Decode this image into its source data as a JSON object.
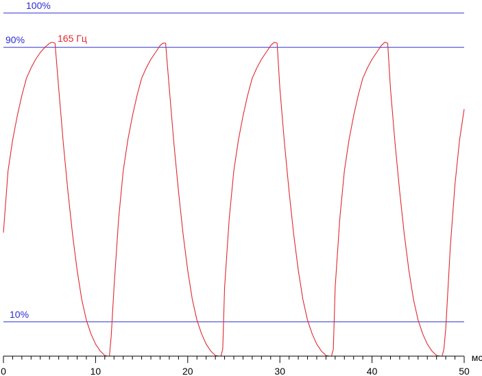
{
  "chart_data": {
    "type": "line",
    "title": "",
    "xlabel": "",
    "ylabel": "",
    "x_unit": "мс",
    "xlim": [
      0,
      50
    ],
    "ylim": [
      0,
      100
    ],
    "x_ticks": [
      0,
      10,
      20,
      30,
      40,
      50
    ],
    "x_minor_step": 1,
    "reference_lines": [
      {
        "label": "100%",
        "value": 100
      },
      {
        "label": "90%",
        "value": 90
      },
      {
        "label": "10%",
        "value": 10
      }
    ],
    "series": [
      {
        "name": "165 Гц",
        "x": [
          0,
          0.5,
          1,
          1.5,
          2,
          2.5,
          3,
          3.5,
          4,
          4.5,
          5.0,
          5.3,
          5.6,
          6,
          6.5,
          7,
          7.5,
          8,
          8.5,
          9,
          9.5,
          10,
          10.5,
          11.0,
          11.3,
          11.5,
          11.7,
          12,
          12.5,
          13,
          13.5,
          14,
          14.5,
          15,
          15.5,
          16,
          16.5,
          17.0,
          17.3,
          17.6,
          18,
          18.5,
          19,
          19.5,
          20,
          20.5,
          21,
          21.5,
          22,
          22.5,
          23.0,
          23.4,
          23.6,
          23.8,
          24,
          24.5,
          25,
          25.5,
          26,
          26.5,
          27,
          27.5,
          28,
          28.5,
          29.0,
          29.4,
          29.7,
          30,
          30.5,
          31,
          31.5,
          32,
          32.5,
          33,
          33.5,
          34,
          34.5,
          35.0,
          35.4,
          35.6,
          35.8,
          36,
          36.5,
          37,
          37.5,
          38,
          38.5,
          39,
          39.5,
          40,
          40.5,
          41.0,
          41.4,
          41.7,
          42,
          42.5,
          43,
          43.5,
          44,
          44.5,
          45,
          45.5,
          46,
          46.5,
          47.0,
          47.4,
          47.6,
          47.8,
          48,
          48.5,
          49,
          49.5,
          50.0
        ],
        "values": [
          36,
          54,
          63,
          70,
          76,
          81,
          84,
          86.5,
          88.5,
          90,
          91.2,
          91.5,
          91.2,
          78,
          62,
          48,
          35.5,
          25,
          16.5,
          10.5,
          6.5,
          3.5,
          1.5,
          0.2,
          0,
          0,
          6,
          20,
          40,
          54,
          63,
          70,
          76,
          81,
          84,
          86.5,
          88.5,
          90.5,
          91.2,
          91.2,
          78,
          62,
          48,
          35.5,
          25,
          16.5,
          10.5,
          6.5,
          3.5,
          1.5,
          0.2,
          0,
          0,
          2,
          20,
          40,
          54,
          63,
          70,
          76,
          81,
          84,
          86.5,
          88.5,
          90.5,
          91.5,
          91.2,
          78,
          62,
          48,
          35.5,
          25,
          16.5,
          10.5,
          6.5,
          3.5,
          1.5,
          0.2,
          0,
          0,
          2,
          20,
          40,
          54,
          63,
          70,
          76,
          81,
          84,
          86.5,
          88.5,
          90.5,
          91.5,
          91.2,
          78,
          62,
          48,
          35.5,
          25,
          16.5,
          10.5,
          6.5,
          3.5,
          1.5,
          0.2,
          0,
          0,
          2,
          8,
          32,
          50,
          63,
          72
        ]
      }
    ]
  },
  "colors": {
    "reference_line": "#2b2bd1",
    "series": "#e0262d",
    "axis": "#000000"
  }
}
